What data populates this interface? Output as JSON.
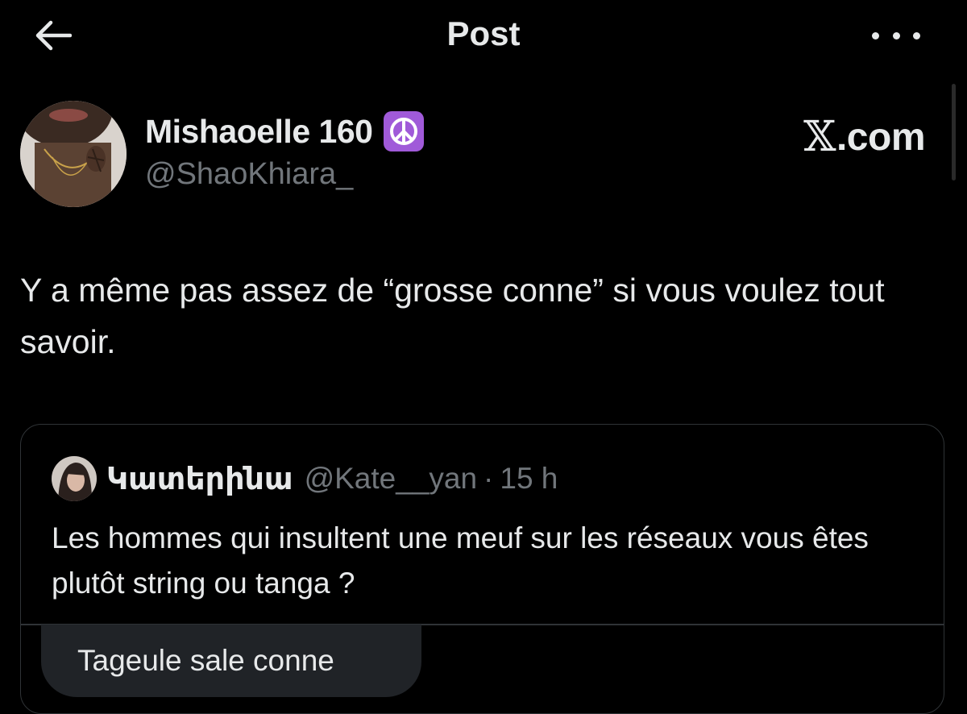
{
  "header": {
    "title": "Post",
    "back_icon": "arrow-left-icon",
    "more_icon": "more-horizontal-icon"
  },
  "post": {
    "author": {
      "name": "Mishaoelle 160",
      "badge_emoji": "☮",
      "badge_color": "#a05ad9",
      "handle": "@ShaoKhiara_"
    },
    "text": "Y a même pas assez de “grosse conne” si vous voulez tout savoir."
  },
  "watermark": {
    "x": "𝕏",
    "domain": ".com"
  },
  "quoted_post": {
    "author_name": "Կատերինա",
    "handle": "@Kate__yan",
    "separator": "·",
    "time": "15 h",
    "text": "Les hommes qui insultent une meuf sur les réseaux vous êtes plutôt string ou tanga ?"
  },
  "reply_bubble": {
    "text": "Tageule sale conne"
  },
  "colors": {
    "background": "#000000",
    "text_primary": "#e7e9ea",
    "text_secondary": "#71767b",
    "border": "#2f3336",
    "bubble": "#202327"
  }
}
